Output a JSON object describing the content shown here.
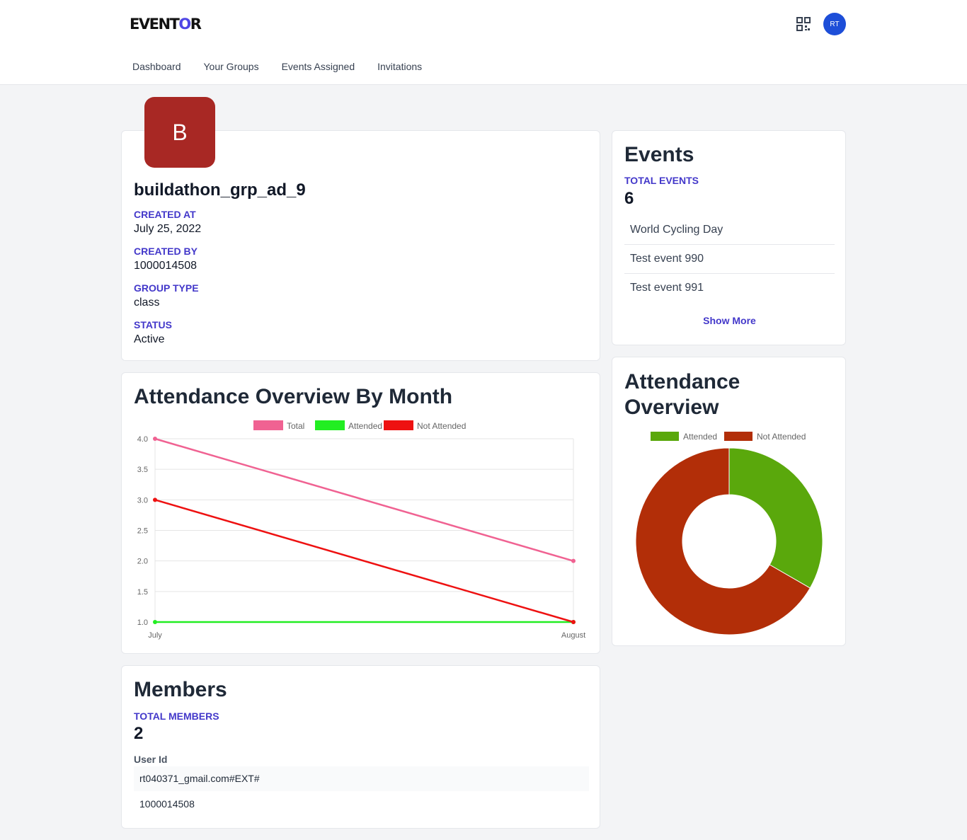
{
  "header": {
    "logo_text_1": "EVENT",
    "logo_text_o": "O",
    "logo_text_2": "R",
    "avatar_initials": "RT",
    "nav": [
      "Dashboard",
      "Your Groups",
      "Events Assigned",
      "Invitations"
    ]
  },
  "group": {
    "avatar_letter": "B",
    "name": "buildathon_grp_ad_9",
    "fields": [
      {
        "label": "CREATED AT",
        "value": "July 25, 2022"
      },
      {
        "label": "CREATED BY",
        "value": "1000014508"
      },
      {
        "label": "GROUP TYPE",
        "value": "class"
      },
      {
        "label": "STATUS",
        "value": "Active"
      }
    ]
  },
  "events": {
    "title": "Events",
    "total_label": "TOTAL EVENTS",
    "total_value": "6",
    "items": [
      "World Cycling Day",
      "Test event 990",
      "Test event 991"
    ],
    "show_more": "Show More"
  },
  "attendance_month": {
    "title": "Attendance Overview By Month"
  },
  "attendance": {
    "title_line1": "Attendance",
    "title_line2": "Overview"
  },
  "members": {
    "title": "Members",
    "total_label": "TOTAL MEMBERS",
    "total_value": "2",
    "column_header": "User Id",
    "rows": [
      "rt040371_gmail.com#EXT#",
      "1000014508"
    ]
  },
  "chart_data": [
    {
      "type": "line",
      "title": "Attendance Overview By Month",
      "categories": [
        "July",
        "August"
      ],
      "yticks": [
        "4.0",
        "3.5",
        "3.0",
        "2.5",
        "2.0",
        "1.5",
        "1.0"
      ],
      "ylim": [
        1,
        4
      ],
      "grid": true,
      "legend_position": "top",
      "series": [
        {
          "name": "Total",
          "values": [
            4,
            2
          ],
          "color": "#f06292"
        },
        {
          "name": "Attended",
          "values": [
            1,
            1
          ],
          "color": "#22ee22"
        },
        {
          "name": "Not Attended",
          "values": [
            3,
            1
          ],
          "color": "#ee1111"
        }
      ]
    },
    {
      "type": "pie",
      "variant": "doughnut",
      "title": "Attendance Overview",
      "legend_position": "top",
      "slices": [
        {
          "name": "Attended",
          "value": 2,
          "color": "#5aa80c"
        },
        {
          "name": "Not Attended",
          "value": 4,
          "color": "#b22e08"
        }
      ]
    }
  ]
}
